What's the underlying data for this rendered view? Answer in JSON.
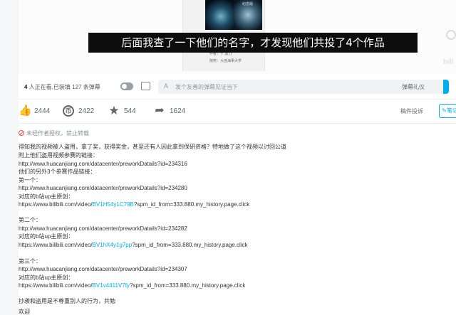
{
  "player": {
    "subtitle": "后面我查了一下他们的名字，才发现他们共投了4个作品",
    "thumb_caption": "纪念版",
    "author_line": "作者：于 嘉力",
    "school_line": "院校：大连海事大学",
    "side_text": "bili"
  },
  "danmaku": {
    "viewers_count": "4",
    "viewers_text": "人正在看,已装填",
    "danmaku_count": "127",
    "danmaku_suffix": "条弹幕",
    "placeholder": "发个友善的弹幕见证当下",
    "etiquette": "弹幕礼仪"
  },
  "toolbar": {
    "like_count": "2444",
    "coin_count": "2422",
    "fav_count": "544",
    "share_count": "1624",
    "report_label": "稿件投诉",
    "note_label": "笔记"
  },
  "description": {
    "notice": "未经作者授权，禁止转载",
    "lines": [
      {
        "text": "得知我的视频被人盗用，拿了奖，获得奖金，甚至还有人因此拿到保研资格？特地做了这个视频以讨回公道"
      },
      {
        "text": "附上他们盗用视频参赛的链接："
      },
      {
        "text": "http://www.huacanjiang.com/datacenter/preworkDatails?id=234316"
      },
      {
        "text": "他们的另外3个参赛作品链接："
      },
      {
        "text": "第一个："
      },
      {
        "text": "http://www.huacanjiang.com/datacenter/preworkDatails?id=234280"
      },
      {
        "text": "对应的b站up主原创："
      },
      {
        "pre": "https://www.bilibili.com/video/",
        "link": "BV1H54y1C79B",
        "post": "?spm_id_from=333.880.my_history.page.click"
      },
      {
        "text": "第二个："
      },
      {
        "text": "http://www.huacanjiang.com/datacenter/preworkDatails?id=234282"
      },
      {
        "text": "对应的b站up主原创："
      },
      {
        "pre": "https://www.bilibili.com/video/",
        "link": "BV1hX4y1g7pp",
        "post": "?spm_id_from=333.880.my_history.page.click"
      },
      {
        "text": "第三个："
      },
      {
        "text": "http://www.huacanjiang.com/datacenter/preworkDatails?id=234307"
      },
      {
        "text": "对应的b站up主原创："
      },
      {
        "pre": "https://www.bilibili.com/video/",
        "link": "BV1v4411V7fy",
        "post": "?spm_id_from=333.880.my_history.page.click"
      },
      {
        "text": "抄袭和盗用是不尊重别人的行为，共勉"
      },
      {
        "text": "欢迎"
      }
    ]
  },
  "colors": {
    "accent": "#00aeec",
    "subtitle_bg": "#0d0d0d",
    "warning": "#f04c49"
  },
  "icons": [
    "toggle-icon",
    "danmaku-settings-icon",
    "like-icon",
    "coin-icon",
    "favorite-icon",
    "share-icon",
    "no-reprint-icon",
    "note-icon"
  ]
}
